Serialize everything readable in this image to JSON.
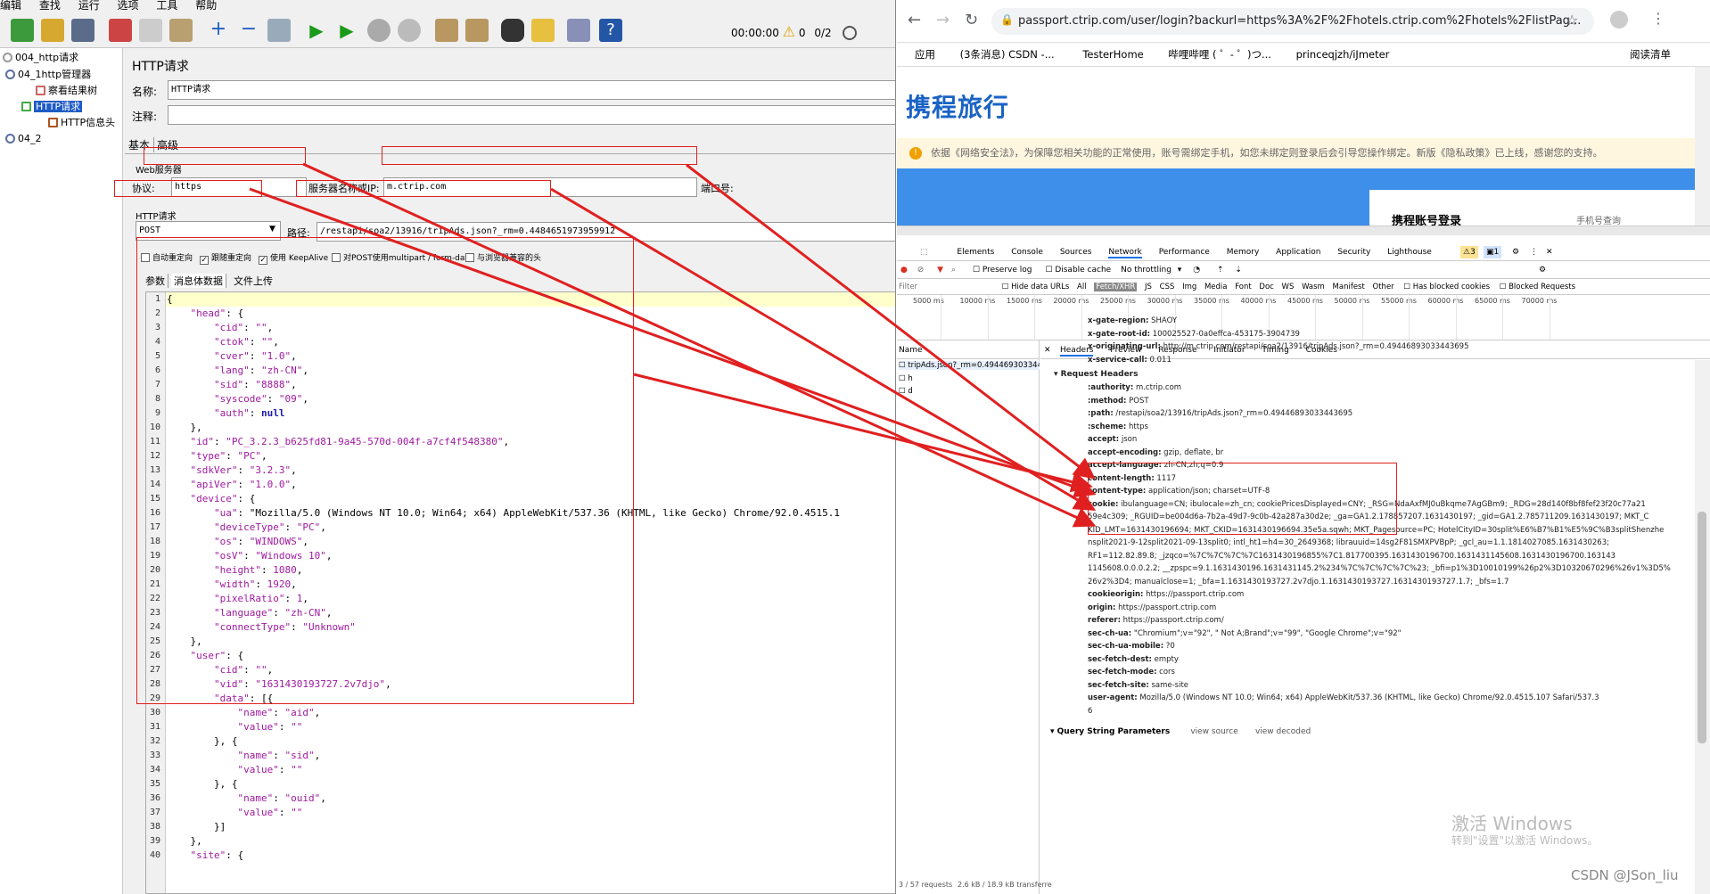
{
  "jmeter": {
    "menu": [
      "编辑",
      "查找",
      "运行",
      "选项",
      "工具",
      "帮助"
    ],
    "timer": "00:00:00",
    "warn_count": "0",
    "threads": "0/2",
    "tree": [
      "004_http请求",
      "04_1http管理器",
      "察看结果树",
      "HTTP请求",
      "HTTP信息头",
      "04_2"
    ],
    "panel_title": "HTTP请求",
    "name_label": "名称:",
    "name_value": "HTTP请求",
    "comment_label": "注释:",
    "tabs": [
      "基本",
      "高级"
    ],
    "web_server_label": "Web服务器",
    "protocol_label": "协议:",
    "protocol_value": "https",
    "server_label": "服务器名称或IP:",
    "server_value": "m.ctrip.com",
    "port_label": "端口号:",
    "http_request_label": "HTTP请求",
    "method_value": "POST",
    "path_label": "路径:",
    "path_value": "/restapi/soa2/13916/tripAds.json?_rm=0.4484651973959912",
    "options": [
      "自动重定向",
      "跟随重定向",
      "使用 KeepAlive",
      "对POST使用multipart / form-data",
      "与浏览器兼容的头"
    ],
    "subtabs": [
      "参数",
      "消息体数据",
      "文件上传"
    ],
    "code_lines": [
      "{",
      "    \"head\": {",
      "        \"cid\": \"\",",
      "        \"ctok\": \"\",",
      "        \"cver\": \"1.0\",",
      "        \"lang\": \"zh-CN\",",
      "        \"sid\": \"8888\",",
      "        \"syscode\": \"09\",",
      "        \"auth\": null",
      "    },",
      "    \"id\": \"PC_3.2.3_b625fd81-9a45-570d-004f-a7cf4f548380\",",
      "    \"type\": \"PC\",",
      "    \"sdkVer\": \"3.2.3\",",
      "    \"apiVer\": \"1.0.0\",",
      "    \"device\": {",
      "        \"ua\": \"Mozilla/5.0 (Windows NT 10.0; Win64; x64) AppleWebKit/537.36 (KHTML, like Gecko) Chrome/92.0.4515.1",
      "        \"deviceType\": \"PC\",",
      "        \"os\": \"WINDOWS\",",
      "        \"osV\": \"Windows 10\",",
      "        \"height\": 1080,",
      "        \"width\": 1920,",
      "        \"pixelRatio\": 1,",
      "        \"language\": \"zh-CN\",",
      "        \"connectType\": \"Unknown\"",
      "    },",
      "    \"user\": {",
      "        \"cid\": \"\",",
      "        \"vid\": \"1631430193727.2v7djo\",",
      "        \"data\": [{",
      "            \"name\": \"aid\",",
      "            \"value\": \"\"",
      "        }, {",
      "            \"name\": \"sid\",",
      "            \"value\": \"\"",
      "        }, {",
      "            \"name\": \"ouid\",",
      "            \"value\": \"\"",
      "        }]",
      "    },",
      "    \"site\": {"
    ]
  },
  "chrome": {
    "url": "passport.ctrip.com/user/login?backurl=https%3A%2F%2Fhotels.ctrip.com%2Fhotels%2FlistPag...",
    "bookmarks": [
      "应用",
      "(3条消息) CSDN -...",
      "TesterHome",
      "哔哩哔哩 ( ゜- ゜)つ...",
      "princeqjzh/iJmeter"
    ],
    "reading_list": "阅读清单",
    "logo": "携程旅行",
    "notice": "依据《网络安全法》，为保障您相关功能的正常使用，账号需绑定手机，如您未绑定则登录后会引导您操作绑定。新版《隐私政策》已上线，感谢您的支持。",
    "login_title": "携程账号登录",
    "phone_login": "手机号查询"
  },
  "devtools": {
    "tabs": [
      "Elements",
      "Console",
      "Sources",
      "Network",
      "Performance",
      "Memory",
      "Application",
      "Security",
      "Lighthouse"
    ],
    "badge_warn": "3",
    "badge_info": "1",
    "preserve_log": "Preserve log",
    "disable_cache": "Disable cache",
    "throttling": "No throttling",
    "filter_label": "Filter",
    "hide_data_urls": "Hide data URLs",
    "types": [
      "All",
      "Fetch/XHR",
      "JS",
      "CSS",
      "Img",
      "Media",
      "Font",
      "Doc",
      "WS",
      "Wasm",
      "Manifest",
      "Other"
    ],
    "blocked_cookies": "Has blocked cookies",
    "blocked_requests": "Blocked Requests",
    "timeline": [
      "5000 ms",
      "10000 ms",
      "15000 ms",
      "20000 ms",
      "25000 ms",
      "30000 ms",
      "35000 ms",
      "40000 ms",
      "45000 ms",
      "50000 ms",
      "55000 ms",
      "60000 ms",
      "65000 ms",
      "70000 ms"
    ],
    "name_col": "Name",
    "requests": [
      "tripAds.json?_rm=0.4944693033443695",
      "h",
      "d"
    ],
    "detail_tabs": [
      "Headers",
      "Preview",
      "Response",
      "Initiator",
      "Timing",
      "Cookies"
    ],
    "status": [
      "3 / 57 requests",
      "2.6 kB / 18.9 kB transferre"
    ],
    "headers_top": [
      {
        "k": "x-gate-region:",
        "v": "SHAOY"
      },
      {
        "k": "x-gate-root-id:",
        "v": "100025527-0a0effca-453175-3904739"
      },
      {
        "k": "x-originating-url:",
        "v": "http://m.ctrip.com/restapi/soa2/13916/tripAds.json?_rm=0.49446893033443695"
      },
      {
        "k": "x-service-call:",
        "v": "0.011"
      }
    ],
    "request_headers_title": "Request Headers",
    "pseudo": [
      {
        "k": ":authority:",
        "v": "m.ctrip.com"
      },
      {
        "k": ":method:",
        "v": "POST"
      },
      {
        "k": ":path:",
        "v": "/restapi/soa2/13916/tripAds.json?_rm=0.49446893033443695"
      },
      {
        "k": ":scheme:",
        "v": "https"
      }
    ],
    "headers": [
      {
        "k": "accept:",
        "v": "json"
      },
      {
        "k": "accept-encoding:",
        "v": "gzip, deflate, br"
      },
      {
        "k": "accept-language:",
        "v": "zh-CN,zh;q=0.9"
      },
      {
        "k": "content-length:",
        "v": "1117"
      },
      {
        "k": "content-type:",
        "v": "application/json; charset=UTF-8"
      },
      {
        "k": "cookie:",
        "v": "ibulanguage=CN; ibulocale=zh_cn; cookiePricesDisplayed=CNY; _RSG=NdaAxfMJ0uBkqme7AgGBm9; _RDG=28d140f8bf8fef23f20c77a21"
      },
      {
        "k": "",
        "v": "59e4c309; _RGUID=be004d6a-7b2a-49d7-9c0b-42a287a30d2e; _ga=GA1.2.178857207.1631430197; _gid=GA1.2.785711209.1631430197; MKT_C"
      },
      {
        "k": "",
        "v": "KID_LMT=1631430196694; MKT_CKID=1631430196694.35e5a.sqwh; MKT_Pagesource=PC; HotelCityID=30split%E6%B7%B1%E5%9C%B3splitShenzhe"
      },
      {
        "k": "",
        "v": "nsplit2021-9-12split2021-09-13split0; intl_ht1=h4=30_2649368; librauuid=14sg2F81SMXPVBpP; _gcl_au=1.1.1814027085.1631430263;"
      },
      {
        "k": "",
        "v": "RF1=112.82.89.8; _jzqco=%7C%7C%7C%7C1631430196855%7C1.817700395.1631430196700.1631431145608.1631430196700.163143"
      },
      {
        "k": "",
        "v": "1145608.0.0.0.2.2; __zpspc=9.1.1631430196.1631431145.2%234%7C%7C%7C%7C%23; _bfi=p1%3D10010199%26p2%3D10320670296%26v1%3D5%"
      },
      {
        "k": "",
        "v": "26v2%3D4; manualclose=1; _bfa=1.1631430193727.2v7djo.1.1631430193727.1631430193727.1.7; _bfs=1.7"
      },
      {
        "k": "cookieorigin:",
        "v": "https://passport.ctrip.com"
      },
      {
        "k": "origin:",
        "v": "https://passport.ctrip.com"
      },
      {
        "k": "referer:",
        "v": "https://passport.ctrip.com/"
      },
      {
        "k": "sec-ch-ua:",
        "v": "\"Chromium\";v=\"92\", \" Not A;Brand\";v=\"99\", \"Google Chrome\";v=\"92\""
      },
      {
        "k": "sec-ch-ua-mobile:",
        "v": "?0"
      },
      {
        "k": "sec-fetch-dest:",
        "v": "empty"
      },
      {
        "k": "sec-fetch-mode:",
        "v": "cors"
      },
      {
        "k": "sec-fetch-site:",
        "v": "same-site"
      },
      {
        "k": "user-agent:",
        "v": "Mozilla/5.0 (Windows NT 10.0; Win64; x64) AppleWebKit/537.36 (KHTML, like Gecko) Chrome/92.0.4515.107 Safari/537.3"
      },
      {
        "k": "",
        "v": "6"
      }
    ],
    "query_params": "Query String Parameters",
    "view_source": "view source",
    "view_decoded": "view decoded"
  },
  "overlay": {
    "watermark": "激活 Windows",
    "watermark_sub": "转到\"设置\"以激活 Windows。",
    "csdn": "CSDN @JSon_liu"
  },
  "colors": {
    "annotation_red": "#e02020",
    "ctrip_blue": "#1a63c5",
    "json_key": "#a01aa0"
  }
}
